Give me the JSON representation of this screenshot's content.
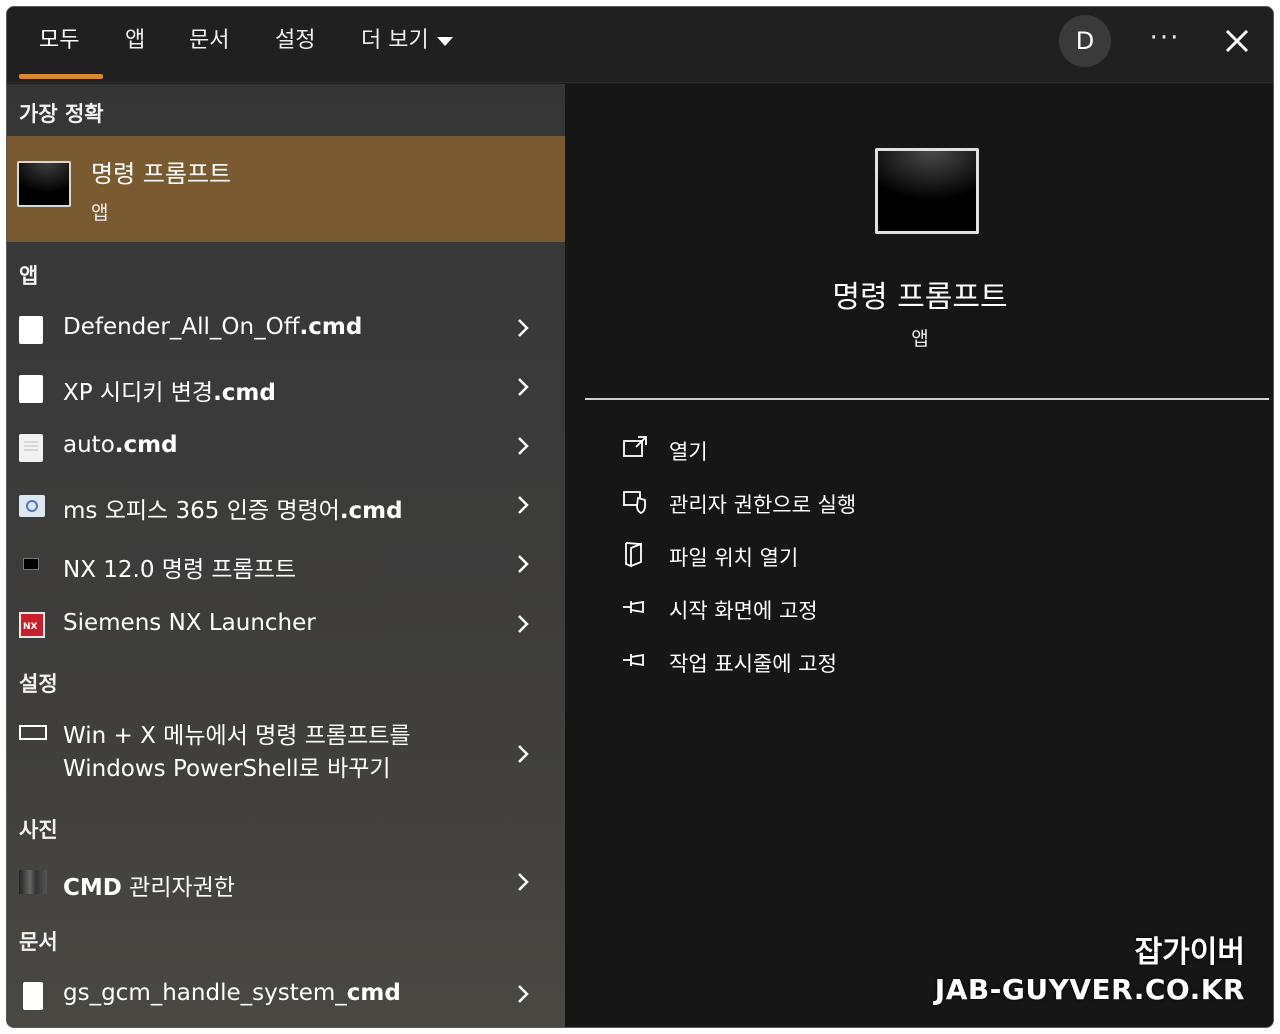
{
  "tabs": [
    {
      "label": "모두",
      "active": true
    },
    {
      "label": "앱"
    },
    {
      "label": "문서"
    },
    {
      "label": "설정"
    },
    {
      "label": "더 보기"
    }
  ],
  "account": {
    "initial": "D"
  },
  "more_options": "···",
  "best_match": {
    "section": "가장 정확",
    "title": "명령 프롬프트",
    "subtitle": "앱"
  },
  "apps": {
    "section": "앱",
    "items": [
      {
        "name": "Defender_All_On_Off",
        "ext": ".cmd"
      },
      {
        "name": "XP 시디키 변경",
        "ext": ".cmd"
      },
      {
        "name": "auto",
        "ext": ".cmd"
      },
      {
        "name": "ms 오피스 365 인증 명령어",
        "ext": ".cmd"
      },
      {
        "name": "NX 12.0 명령 프롬프트",
        "ext": ""
      },
      {
        "name": "Siemens NX Launcher",
        "ext": ""
      }
    ]
  },
  "settings": {
    "section": "설정",
    "item_line1": "Win + X 메뉴에서 명령 프롬프트를",
    "item_line2": "Windows PowerShell로 바꾸기"
  },
  "photos": {
    "section": "사진",
    "item_bold": "CMD",
    "item_rest": " 관리자권한"
  },
  "documents": {
    "section": "문서",
    "item_name": "gs_gcm_handle_system_",
    "item_bold": "cmd"
  },
  "preview": {
    "title": "명령 프롬프트",
    "subtitle": "앱",
    "actions": [
      {
        "label": "열기",
        "icon": "open-icon"
      },
      {
        "label": "관리자 권한으로 실행",
        "icon": "shield-icon"
      },
      {
        "label": "파일 위치 열기",
        "icon": "folder-icon"
      },
      {
        "label": "시작 화면에 고정",
        "icon": "pin-icon"
      },
      {
        "label": "작업 표시줄에 고정",
        "icon": "pin-icon"
      }
    ]
  },
  "watermark": {
    "line1": "잡가이버",
    "line2": "JAB-GUYVER.CO.KR"
  },
  "colors": {
    "accent": "#d9892f",
    "selected_row": "#7a5a30"
  }
}
